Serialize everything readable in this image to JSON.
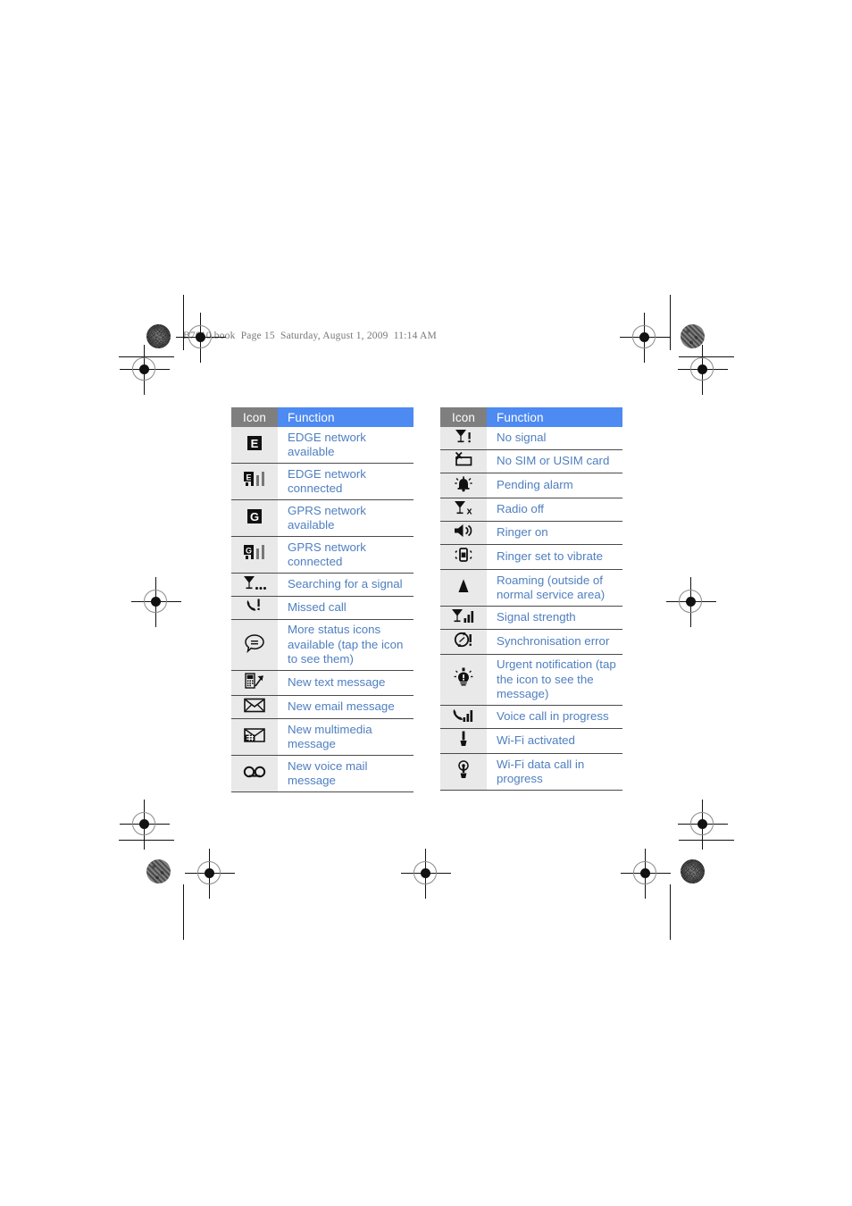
{
  "print_header": "B7610.book  Page 15  Saturday, August 1, 2009  11:14 AM",
  "colors": {
    "header_icon_bg": "#7f7f7f",
    "header_function_bg": "#4d8af2",
    "icon_cell_bg": "#e9e9e9",
    "function_text": "#4f7fc0",
    "rule": "#4a4a4a",
    "header_text": "#ffffff"
  },
  "tables": [
    {
      "id": "left-status-icon-table",
      "columns": {
        "icon": "Icon",
        "function": "Function"
      },
      "rows": [
        {
          "icon": "edge-available-icon",
          "function": "EDGE network available"
        },
        {
          "icon": "edge-connected-icon",
          "function": "EDGE network connected"
        },
        {
          "icon": "gprs-available-icon",
          "function": "GPRS network available"
        },
        {
          "icon": "gprs-connected-icon",
          "function": "GPRS network connected"
        },
        {
          "icon": "searching-signal-icon",
          "function": "Searching for a signal"
        },
        {
          "icon": "missed-call-icon",
          "function": "Missed call"
        },
        {
          "icon": "more-status-icons-icon",
          "function": "More status icons available (tap the icon to see them)"
        },
        {
          "icon": "new-text-message-icon",
          "function": "New text message"
        },
        {
          "icon": "new-email-message-icon",
          "function": "New email message"
        },
        {
          "icon": "new-multimedia-message-icon",
          "function": "New multimedia message"
        },
        {
          "icon": "new-voice-mail-icon",
          "function": "New voice mail message"
        }
      ]
    },
    {
      "id": "right-status-icon-table",
      "columns": {
        "icon": "Icon",
        "function": "Function"
      },
      "rows": [
        {
          "icon": "no-signal-icon",
          "function": "No signal"
        },
        {
          "icon": "no-sim-card-icon",
          "function": "No SIM or USIM card"
        },
        {
          "icon": "pending-alarm-icon",
          "function": "Pending alarm"
        },
        {
          "icon": "radio-off-icon",
          "function": "Radio off"
        },
        {
          "icon": "ringer-on-icon",
          "function": "Ringer on"
        },
        {
          "icon": "ringer-vibrate-icon",
          "function": "Ringer set to vibrate"
        },
        {
          "icon": "roaming-icon",
          "function": "Roaming (outside of normal service area)"
        },
        {
          "icon": "signal-strength-icon",
          "function": "Signal strength"
        },
        {
          "icon": "sync-error-icon",
          "function": "Synchronisation error"
        },
        {
          "icon": "urgent-notification-icon",
          "function": "Urgent notification (tap the icon to see the message)"
        },
        {
          "icon": "voice-call-progress-icon",
          "function": "Voice call in progress"
        },
        {
          "icon": "wifi-activated-icon",
          "function": "Wi-Fi activated"
        },
        {
          "icon": "wifi-data-call-icon",
          "function": "Wi-Fi data call in progress"
        }
      ]
    }
  ]
}
